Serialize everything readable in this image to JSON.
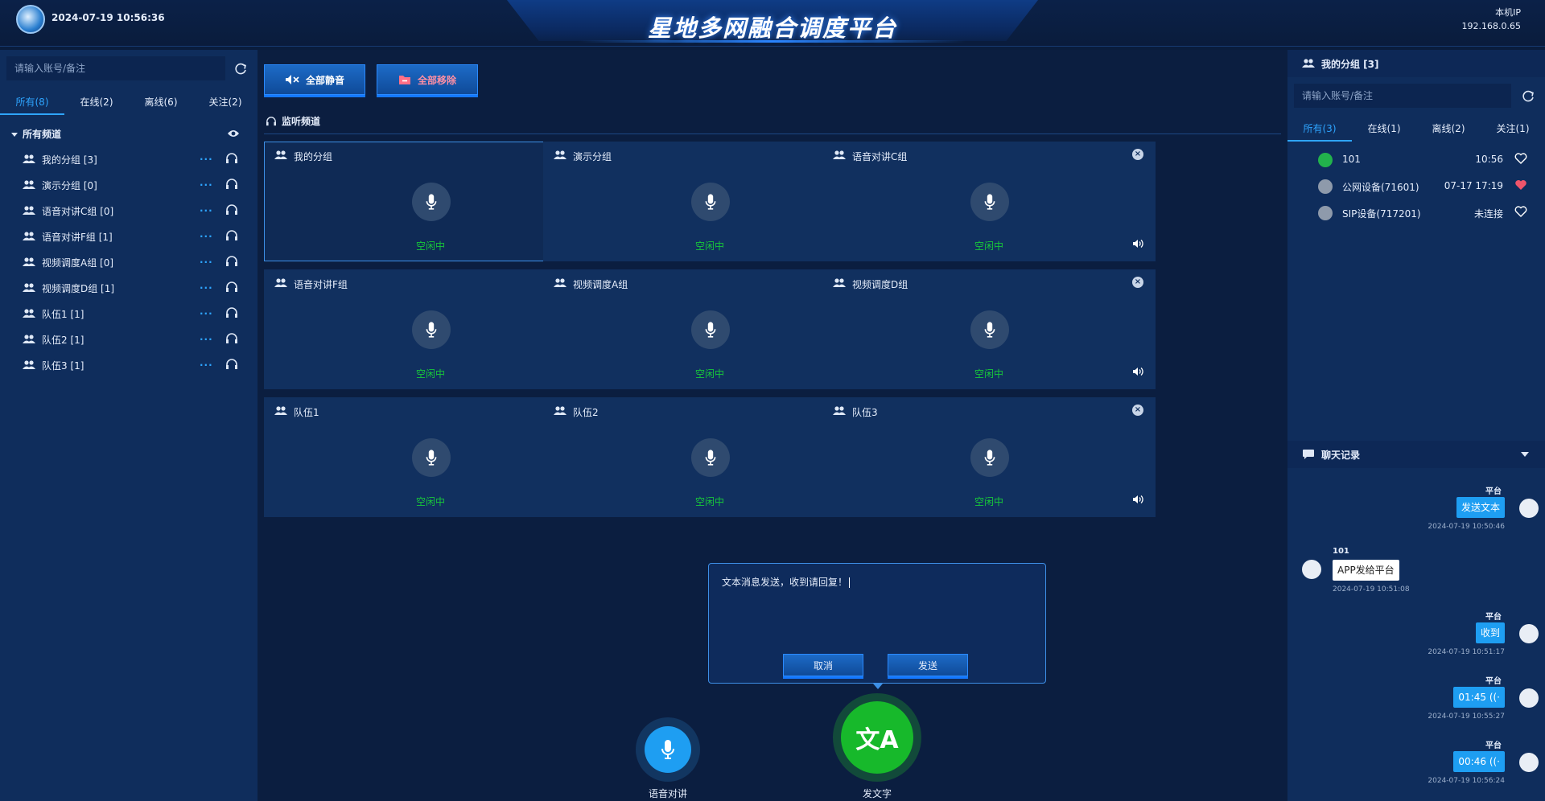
{
  "header": {
    "datetime": "2024-07-19 10:56:36",
    "title": "星地多网融合调度平台",
    "ip_label": "本机IP",
    "ip_value": "192.168.0.65"
  },
  "left": {
    "search_placeholder": "请输入账号/备注",
    "tabs": [
      "所有(8)",
      "在线(2)",
      "离线(6)",
      "关注(2)"
    ],
    "group_title": "所有频道",
    "groups": [
      "我的分组 [3]",
      "演示分组 [0]",
      "语音对讲C组 [0]",
      "语音对讲F组 [1]",
      "视频调度A组 [0]",
      "视频调度D组 [1]",
      "队伍1 [1]",
      "队伍2 [1]",
      "队伍3 [1]"
    ]
  },
  "center": {
    "mute_all": "全部静音",
    "remove_all": "全部移除",
    "monitor_title": "监听频道",
    "channels": [
      {
        "name": "我的分组",
        "status": "空闲中"
      },
      {
        "name": "演示分组",
        "status": "空闲中"
      },
      {
        "name": "语音对讲C组",
        "status": "空闲中"
      },
      {
        "name": "语音对讲F组",
        "status": "空闲中"
      },
      {
        "name": "视频调度A组",
        "status": "空闲中"
      },
      {
        "name": "视频调度D组",
        "status": "空闲中"
      },
      {
        "name": "队伍1",
        "status": "空闲中"
      },
      {
        "name": "队伍2",
        "status": "空闲中"
      },
      {
        "name": "队伍3",
        "status": "空闲中"
      }
    ],
    "dialog": {
      "text": "文本消息发送，收到请回复！",
      "cancel": "取消",
      "send": "发送"
    },
    "voice_label": "语音对讲",
    "text_label": "发文字",
    "text_glyph": "文A"
  },
  "right": {
    "group_header": "我的分组 [3]",
    "search_placeholder": "请输入账号/备注",
    "tabs": [
      "所有(3)",
      "在线(1)",
      "离线(2)",
      "关注(1)"
    ],
    "users": [
      {
        "name": "101",
        "time": "10:56",
        "fav": false,
        "online": true
      },
      {
        "name": "公网设备(71601)",
        "time": "07-17 17:19",
        "fav": true,
        "online": false
      },
      {
        "name": "SIP设备(717201)",
        "time": "未连接",
        "fav": false,
        "online": false
      }
    ],
    "chat_header": "聊天记录",
    "messages": [
      {
        "sender": "平台",
        "text": "发送文本",
        "time": "2024-07-19 10:50:46",
        "mine": true
      },
      {
        "sender": "101",
        "text": "APP发给平台",
        "time": "2024-07-19 10:51:08",
        "mine": false
      },
      {
        "sender": "平台",
        "text": "收到",
        "time": "2024-07-19 10:51:17",
        "mine": true
      },
      {
        "sender": "平台",
        "text": "01:45",
        "time": "2024-07-19 10:55:27",
        "mine": true
      },
      {
        "sender": "平台",
        "text": "00:46",
        "time": "2024-07-19 10:56:24",
        "mine": true
      }
    ]
  },
  "colors": {
    "accent": "#2ea5ff",
    "idle": "#18c83a",
    "fav": "#f0556b",
    "bg": "#0a1d3d",
    "panel": "#0f2d5c"
  }
}
